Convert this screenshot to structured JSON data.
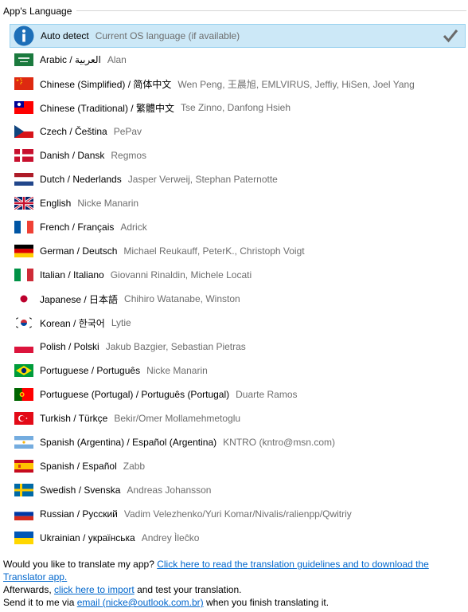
{
  "group_title": "App's Language",
  "auto_detect": {
    "name": "Auto detect",
    "description": "Current OS language (if available)",
    "selected": true
  },
  "languages": [
    {
      "name": "Arabic / العربية",
      "translators": "Alan",
      "flag": "flag-saudi-arabia"
    },
    {
      "name": "Chinese (Simplified) / 简体中文",
      "translators": "Wen Peng, 王晨旭, EMLVIRUS, Jeffiy, HiSen, Joel Yang",
      "flag": "flag-china"
    },
    {
      "name": "Chinese (Traditional) / 繁體中文",
      "translators": "Tse Zinno, Danfong Hsieh",
      "flag": "flag-taiwan"
    },
    {
      "name": "Czech / Čeština",
      "translators": "PePav",
      "flag": "flag-czech"
    },
    {
      "name": "Danish / Dansk",
      "translators": "Regmos",
      "flag": "flag-denmark"
    },
    {
      "name": "Dutch / Nederlands",
      "translators": "Jasper Verweij, Stephan Paternotte",
      "flag": "flag-netherlands"
    },
    {
      "name": "English",
      "translators": "Nicke Manarin",
      "flag": "flag-uk"
    },
    {
      "name": "French / Français",
      "translators": "Adrick",
      "flag": "flag-france"
    },
    {
      "name": "German / Deutsch",
      "translators": "Michael Reukauff, PeterK., Christoph Voigt",
      "flag": "flag-germany"
    },
    {
      "name": "Italian / Italiano",
      "translators": "Giovanni Rinaldin, Michele Locati",
      "flag": "flag-italy"
    },
    {
      "name": "Japanese / 日本語",
      "translators": "Chihiro Watanabe, Winston",
      "flag": "flag-japan"
    },
    {
      "name": "Korean / 한국어",
      "translators": "Lytie",
      "flag": "flag-korea"
    },
    {
      "name": "Polish / Polski",
      "translators": "Jakub Bazgier, Sebastian Pietras",
      "flag": "flag-poland"
    },
    {
      "name": "Portuguese / Português",
      "translators": "Nicke Manarin",
      "flag": "flag-brazil"
    },
    {
      "name": "Portuguese (Portugal) / Português (Portugal)",
      "translators": "Duarte Ramos",
      "flag": "flag-portugal"
    },
    {
      "name": "Turkish / Türkçe",
      "translators": "Bekir/Omer Mollamehmetoglu",
      "flag": "flag-turkey"
    },
    {
      "name": "Spanish (Argentina) / Español (Argentina)",
      "translators": "KNTRO (kntro@msn.com)",
      "flag": "flag-argentina"
    },
    {
      "name": "Spanish / Español",
      "translators": "Zabb",
      "flag": "flag-spain"
    },
    {
      "name": "Swedish / Svenska",
      "translators": "Andreas Johansson",
      "flag": "flag-sweden"
    },
    {
      "name": "Russian / Русский",
      "translators": "Vadim Velezhenko/Yuri Komar/Nivalis/ralienpp/Qwitriy",
      "flag": "flag-russia"
    },
    {
      "name": "Ukrainian / українська",
      "translators": "Andrey Ìleĉko",
      "flag": "flag-ukraine"
    }
  ],
  "footer": {
    "line1_text": "Would you like to translate my app? ",
    "line1_link": "Click here to read the translation guidelines and to download the Translator app.",
    "line2_text_before": "Afterwards, ",
    "line2_link": "click here to import",
    "line2_text_after": " and test your translation.",
    "line3_text_before": "Send it to me via ",
    "line3_link": "email (nicke@outlook.com.br)",
    "line3_text_after": " when you finish translating it."
  }
}
